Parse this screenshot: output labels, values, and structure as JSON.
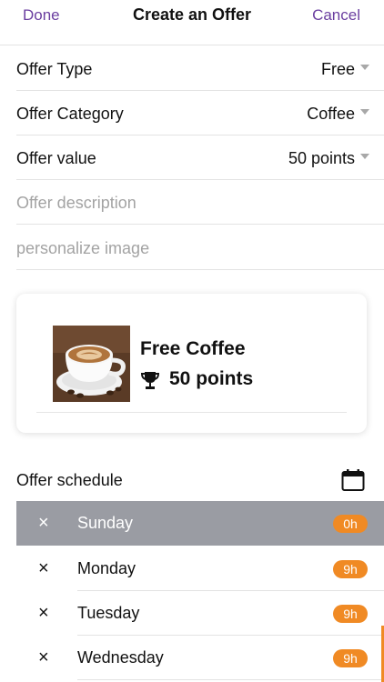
{
  "nav": {
    "done": "Done",
    "title": "Create an Offer",
    "cancel": "Cancel"
  },
  "form": {
    "offer_type": {
      "label": "Offer Type",
      "value": "Free"
    },
    "offer_category": {
      "label": "Offer Category",
      "value": "Coffee"
    },
    "offer_value": {
      "label": "Offer value",
      "value": "50 points"
    },
    "description_placeholder": "Offer description",
    "image_placeholder": "personalize image"
  },
  "preview": {
    "title": "Free Coffee",
    "points": "50 points"
  },
  "schedule": {
    "label": "Offer schedule",
    "days": [
      {
        "name": "Sunday",
        "hours": "0h",
        "selected": true
      },
      {
        "name": "Monday",
        "hours": "9h",
        "selected": false
      },
      {
        "name": "Tuesday",
        "hours": "9h",
        "selected": false
      },
      {
        "name": "Wednesday",
        "hours": "9h",
        "selected": false
      }
    ],
    "remove_glyph": "×"
  },
  "colors": {
    "accent": "#6b3fa0",
    "badge": "#f08a24",
    "selected_row": "#9a9ca3"
  },
  "icons": [
    "caret-down-icon",
    "trophy-icon",
    "calendar-icon",
    "remove-icon"
  ]
}
